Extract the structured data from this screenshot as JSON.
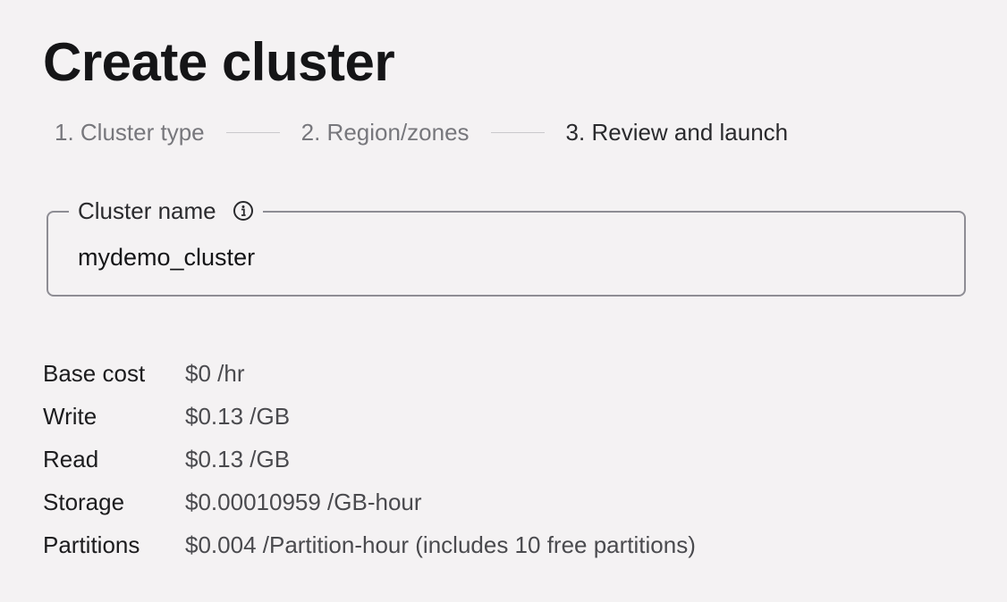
{
  "page": {
    "title": "Create cluster"
  },
  "stepper": {
    "steps": [
      {
        "label": "1. Cluster type",
        "state": "inactive"
      },
      {
        "label": "2. Region/zones",
        "state": "inactive"
      },
      {
        "label": "3. Review and launch",
        "state": "active"
      }
    ]
  },
  "cluster_name": {
    "label": "Cluster name",
    "value": "mydemo_cluster",
    "info_icon": "info-circle-icon"
  },
  "pricing": {
    "rows": [
      {
        "label": "Base cost",
        "value": "$0 /hr"
      },
      {
        "label": "Write",
        "value": "$0.13 /GB"
      },
      {
        "label": "Read",
        "value": "$0.13 /GB"
      },
      {
        "label": "Storage",
        "value": "$0.00010959 /GB-hour"
      },
      {
        "label": "Partitions",
        "value": "$0.004 /Partition-hour (includes 10 free partitions)"
      }
    ]
  },
  "colors": {
    "background": "#f4f2f3",
    "text": "#151517",
    "muted_text": "#77777c",
    "field_border": "#8e8d94"
  }
}
